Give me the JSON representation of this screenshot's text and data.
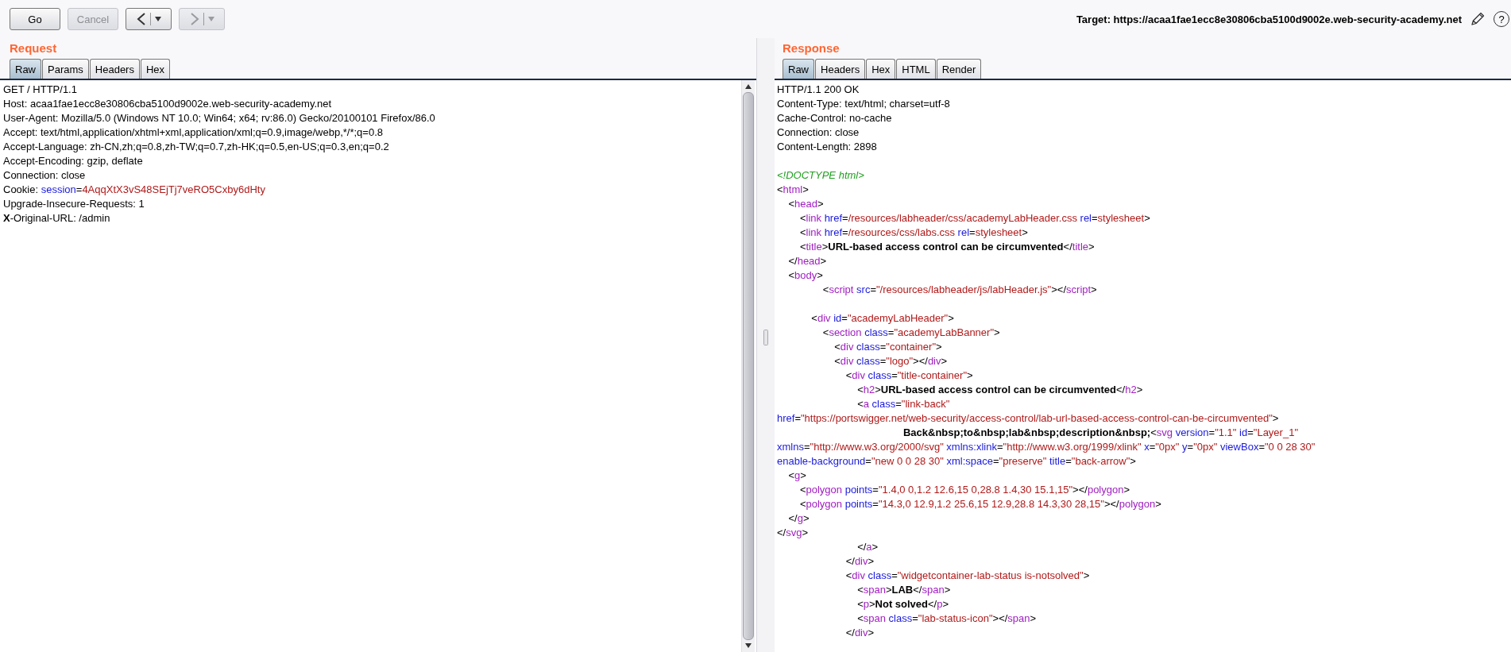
{
  "toolbar": {
    "buttons": [
      {
        "kind": "text",
        "label": "Go",
        "disabled": false
      },
      {
        "kind": "text",
        "label": "Cancel",
        "disabled": true
      },
      {
        "kind": "back",
        "disabled": false
      },
      {
        "kind": "forward",
        "disabled": true
      }
    ],
    "target": "Target: https://acaa1fae1ecc8e30806cba5100d9002e.web-security-academy.net",
    "help_label": "?"
  },
  "request": {
    "title": "Request",
    "tabs": [
      {
        "label": "Raw",
        "selected": true
      },
      {
        "label": "Params",
        "selected": false
      },
      {
        "label": "Headers",
        "selected": false
      },
      {
        "label": "Hex",
        "selected": false
      }
    ],
    "lines": [
      {
        "kind": "code",
        "segments": [
          {
            "kind": "plain",
            "text": "GET / HTTP/1.1"
          }
        ]
      },
      {
        "kind": "code",
        "segments": [
          {
            "kind": "plain",
            "text": "Host: acaa1fae1ecc8e30806cba5100d9002e.web-security-academy.net"
          }
        ]
      },
      {
        "kind": "code",
        "segments": [
          {
            "kind": "plain",
            "text": "User-Agent: Mozilla/5.0 (Windows NT 10.0; Win64; x64; rv:86.0) Gecko/20100101 Firefox/86.0"
          }
        ]
      },
      {
        "kind": "code",
        "segments": [
          {
            "kind": "plain",
            "text": "Accept: text/html,application/xhtml+xml,application/xml;q=0.9,image/webp,*/*;q=0.8"
          }
        ]
      },
      {
        "kind": "code",
        "segments": [
          {
            "kind": "plain",
            "text": "Accept-Language: zh-CN,zh;q=0.8,zh-TW;q=0.7,zh-HK;q=0.5,en-US;q=0.3,en;q=0.2"
          }
        ]
      },
      {
        "kind": "code",
        "segments": [
          {
            "kind": "plain",
            "text": "Accept-Encoding: gzip, deflate"
          }
        ]
      },
      {
        "kind": "code",
        "segments": [
          {
            "kind": "plain",
            "text": "Connection: close"
          }
        ]
      },
      {
        "kind": "code",
        "segments": [
          {
            "kind": "plain",
            "text": "Cookie: "
          },
          {
            "kind": "attr",
            "text": "session"
          },
          {
            "kind": "plain",
            "text": "="
          },
          {
            "kind": "value",
            "text": "4AqqXtX3vS48SEjTj7veRO5Cxby6dHty"
          }
        ]
      },
      {
        "kind": "code",
        "segments": [
          {
            "kind": "plain",
            "text": "Upgrade-Insecure-Requests: 1"
          }
        ]
      },
      {
        "kind": "code",
        "segments": [
          {
            "kind": "bold",
            "text": "X"
          },
          {
            "kind": "plain",
            "text": "-Original-URL: /admin"
          }
        ]
      }
    ]
  },
  "response": {
    "title": "Response",
    "tabs": [
      {
        "label": "Raw",
        "selected": true
      },
      {
        "label": "Headers",
        "selected": false
      },
      {
        "label": "Hex",
        "selected": false
      },
      {
        "label": "HTML",
        "selected": false
      },
      {
        "label": "Render",
        "selected": false
      }
    ],
    "lines": [
      {
        "kind": "code",
        "segments": [
          {
            "kind": "plain",
            "text": "HTTP/1.1 200 OK"
          }
        ]
      },
      {
        "kind": "code",
        "segments": [
          {
            "kind": "plain",
            "text": "Content-Type: text/html; charset=utf-8"
          }
        ]
      },
      {
        "kind": "code",
        "segments": [
          {
            "kind": "plain",
            "text": "Cache-Control: no-cache"
          }
        ]
      },
      {
        "kind": "code",
        "segments": [
          {
            "kind": "plain",
            "text": "Connection: close"
          }
        ]
      },
      {
        "kind": "code",
        "segments": [
          {
            "kind": "plain",
            "text": "Content-Length: 2898"
          }
        ]
      },
      {
        "kind": "blank"
      },
      {
        "kind": "code",
        "segments": [
          {
            "kind": "comment",
            "text": "<!DOCTYPE html>"
          }
        ]
      },
      {
        "kind": "code",
        "segments": [
          {
            "kind": "plain",
            "text": "<"
          },
          {
            "kind": "tag",
            "text": "html"
          },
          {
            "kind": "plain",
            "text": ">"
          }
        ]
      },
      {
        "kind": "code",
        "segments": [
          {
            "kind": "plain",
            "text": "    <"
          },
          {
            "kind": "tag",
            "text": "head"
          },
          {
            "kind": "plain",
            "text": ">"
          }
        ]
      },
      {
        "kind": "code",
        "segments": [
          {
            "kind": "plain",
            "text": "        <"
          },
          {
            "kind": "tag",
            "text": "link"
          },
          {
            "kind": "attr",
            "text": " href"
          },
          {
            "kind": "plain",
            "text": "="
          },
          {
            "kind": "value",
            "text": "/resources/labheader/css/academyLabHeader.css"
          },
          {
            "kind": "attr",
            "text": " rel"
          },
          {
            "kind": "plain",
            "text": "="
          },
          {
            "kind": "value",
            "text": "stylesheet"
          },
          {
            "kind": "plain",
            "text": ">"
          }
        ]
      },
      {
        "kind": "code",
        "segments": [
          {
            "kind": "plain",
            "text": "        <"
          },
          {
            "kind": "tag",
            "text": "link"
          },
          {
            "kind": "attr",
            "text": " href"
          },
          {
            "kind": "plain",
            "text": "="
          },
          {
            "kind": "value",
            "text": "/resources/css/labs.css"
          },
          {
            "kind": "attr",
            "text": " rel"
          },
          {
            "kind": "plain",
            "text": "="
          },
          {
            "kind": "value",
            "text": "stylesheet"
          },
          {
            "kind": "plain",
            "text": ">"
          }
        ]
      },
      {
        "kind": "code",
        "segments": [
          {
            "kind": "plain",
            "text": "        <"
          },
          {
            "kind": "tag",
            "text": "title"
          },
          {
            "kind": "plain",
            "text": ">"
          },
          {
            "kind": "bold",
            "text": "URL-based access control can be circumvented"
          },
          {
            "kind": "plain",
            "text": "</"
          },
          {
            "kind": "tag",
            "text": "title"
          },
          {
            "kind": "plain",
            "text": ">"
          }
        ]
      },
      {
        "kind": "code",
        "segments": [
          {
            "kind": "plain",
            "text": "    </"
          },
          {
            "kind": "tag",
            "text": "head"
          },
          {
            "kind": "plain",
            "text": ">"
          }
        ]
      },
      {
        "kind": "code",
        "segments": [
          {
            "kind": "plain",
            "text": "    <"
          },
          {
            "kind": "tag",
            "text": "body"
          },
          {
            "kind": "plain",
            "text": ">"
          }
        ]
      },
      {
        "kind": "code",
        "segments": [
          {
            "kind": "plain",
            "text": "                <"
          },
          {
            "kind": "tag",
            "text": "script"
          },
          {
            "kind": "attr",
            "text": " src"
          },
          {
            "kind": "plain",
            "text": "="
          },
          {
            "kind": "value",
            "text": "\"/resources/labheader/js/labHeader.js\""
          },
          {
            "kind": "plain",
            "text": "></"
          },
          {
            "kind": "tag",
            "text": "script"
          },
          {
            "kind": "plain",
            "text": ">"
          }
        ]
      },
      {
        "kind": "blank"
      },
      {
        "kind": "code",
        "segments": [
          {
            "kind": "plain",
            "text": "            <"
          },
          {
            "kind": "tag",
            "text": "div"
          },
          {
            "kind": "attr",
            "text": " id"
          },
          {
            "kind": "plain",
            "text": "="
          },
          {
            "kind": "value",
            "text": "\"academyLabHeader\""
          },
          {
            "kind": "plain",
            "text": ">"
          }
        ]
      },
      {
        "kind": "code",
        "segments": [
          {
            "kind": "plain",
            "text": "                <"
          },
          {
            "kind": "tag",
            "text": "section"
          },
          {
            "kind": "attr",
            "text": " class"
          },
          {
            "kind": "plain",
            "text": "="
          },
          {
            "kind": "value",
            "text": "\"academyLabBanner\""
          },
          {
            "kind": "plain",
            "text": ">"
          }
        ]
      },
      {
        "kind": "code",
        "segments": [
          {
            "kind": "plain",
            "text": "                    <"
          },
          {
            "kind": "tag",
            "text": "div"
          },
          {
            "kind": "attr",
            "text": " class"
          },
          {
            "kind": "plain",
            "text": "="
          },
          {
            "kind": "value",
            "text": "\"container\""
          },
          {
            "kind": "plain",
            "text": ">"
          }
        ]
      },
      {
        "kind": "code",
        "segments": [
          {
            "kind": "plain",
            "text": "                    <"
          },
          {
            "kind": "tag",
            "text": "div"
          },
          {
            "kind": "attr",
            "text": " class"
          },
          {
            "kind": "plain",
            "text": "="
          },
          {
            "kind": "value",
            "text": "\"logo\""
          },
          {
            "kind": "plain",
            "text": "></"
          },
          {
            "kind": "tag",
            "text": "div"
          },
          {
            "kind": "plain",
            "text": ">"
          }
        ]
      },
      {
        "kind": "code",
        "segments": [
          {
            "kind": "plain",
            "text": "                        <"
          },
          {
            "kind": "tag",
            "text": "div"
          },
          {
            "kind": "attr",
            "text": " class"
          },
          {
            "kind": "plain",
            "text": "="
          },
          {
            "kind": "value",
            "text": "\"title-container\""
          },
          {
            "kind": "plain",
            "text": ">"
          }
        ]
      },
      {
        "kind": "code",
        "segments": [
          {
            "kind": "plain",
            "text": "                            <"
          },
          {
            "kind": "tag",
            "text": "h2"
          },
          {
            "kind": "plain",
            "text": ">"
          },
          {
            "kind": "bold",
            "text": "URL-based access control can be circumvented"
          },
          {
            "kind": "plain",
            "text": "</"
          },
          {
            "kind": "tag",
            "text": "h2"
          },
          {
            "kind": "plain",
            "text": ">"
          }
        ]
      },
      {
        "kind": "code",
        "segments": [
          {
            "kind": "plain",
            "text": "                            <"
          },
          {
            "kind": "tag",
            "text": "a"
          },
          {
            "kind": "attr",
            "text": " class"
          },
          {
            "kind": "plain",
            "text": "="
          },
          {
            "kind": "value",
            "text": "\"link-back\""
          }
        ]
      },
      {
        "kind": "code",
        "segments": [
          {
            "kind": "attr",
            "text": "href"
          },
          {
            "kind": "plain",
            "text": "="
          },
          {
            "kind": "value",
            "text": "\"https://portswigger.net/web-security/access-control/lab-url-based-access-control-can-be-circumvented\""
          },
          {
            "kind": "plain",
            "text": ">"
          }
        ]
      },
      {
        "kind": "code",
        "segments": [
          {
            "kind": "bold",
            "text": "                                            Back&nbsp;to&nbsp;lab&nbsp;description&nbsp;"
          },
          {
            "kind": "plain",
            "text": "<"
          },
          {
            "kind": "tag",
            "text": "svg"
          },
          {
            "kind": "attr",
            "text": " version"
          },
          {
            "kind": "plain",
            "text": "="
          },
          {
            "kind": "value",
            "text": "\"1.1\""
          },
          {
            "kind": "attr",
            "text": " id"
          },
          {
            "kind": "plain",
            "text": "="
          },
          {
            "kind": "value",
            "text": "\"Layer_1\""
          }
        ]
      },
      {
        "kind": "code",
        "segments": [
          {
            "kind": "attr",
            "text": "xmlns"
          },
          {
            "kind": "plain",
            "text": "="
          },
          {
            "kind": "value",
            "text": "\"http://www.w3.org/2000/svg\""
          },
          {
            "kind": "attr",
            "text": " xmlns:xlink"
          },
          {
            "kind": "plain",
            "text": "="
          },
          {
            "kind": "value",
            "text": "\"http://www.w3.org/1999/xlink\""
          },
          {
            "kind": "attr",
            "text": " x"
          },
          {
            "kind": "plain",
            "text": "="
          },
          {
            "kind": "value",
            "text": "\"0px\""
          },
          {
            "kind": "attr",
            "text": " y"
          },
          {
            "kind": "plain",
            "text": "="
          },
          {
            "kind": "value",
            "text": "\"0px\""
          },
          {
            "kind": "attr",
            "text": " viewBox"
          },
          {
            "kind": "plain",
            "text": "="
          },
          {
            "kind": "value",
            "text": "\"0 0 28 30\""
          }
        ]
      },
      {
        "kind": "code",
        "segments": [
          {
            "kind": "attr",
            "text": "enable-background"
          },
          {
            "kind": "plain",
            "text": "="
          },
          {
            "kind": "value",
            "text": "\"new 0 0 28 30\""
          },
          {
            "kind": "attr",
            "text": " xml:space"
          },
          {
            "kind": "plain",
            "text": "="
          },
          {
            "kind": "value",
            "text": "\"preserve\""
          },
          {
            "kind": "attr",
            "text": " title"
          },
          {
            "kind": "plain",
            "text": "="
          },
          {
            "kind": "value",
            "text": "\"back-arrow\""
          },
          {
            "kind": "plain",
            "text": ">"
          }
        ]
      },
      {
        "kind": "code",
        "segments": [
          {
            "kind": "plain",
            "text": "    <"
          },
          {
            "kind": "tag",
            "text": "g"
          },
          {
            "kind": "plain",
            "text": ">"
          }
        ]
      },
      {
        "kind": "code",
        "segments": [
          {
            "kind": "plain",
            "text": "        <"
          },
          {
            "kind": "tag",
            "text": "polygon"
          },
          {
            "kind": "attr",
            "text": " points"
          },
          {
            "kind": "plain",
            "text": "="
          },
          {
            "kind": "value",
            "text": "\"1.4,0 0,1.2 12.6,15 0,28.8 1.4,30 15.1,15\""
          },
          {
            "kind": "plain",
            "text": "></"
          },
          {
            "kind": "tag",
            "text": "polygon"
          },
          {
            "kind": "plain",
            "text": ">"
          }
        ]
      },
      {
        "kind": "code",
        "segments": [
          {
            "kind": "plain",
            "text": "        <"
          },
          {
            "kind": "tag",
            "text": "polygon"
          },
          {
            "kind": "attr",
            "text": " points"
          },
          {
            "kind": "plain",
            "text": "="
          },
          {
            "kind": "value",
            "text": "\"14.3,0 12.9,1.2 25.6,15 12.9,28.8 14.3,30 28,15\""
          },
          {
            "kind": "plain",
            "text": "></"
          },
          {
            "kind": "tag",
            "text": "polygon"
          },
          {
            "kind": "plain",
            "text": ">"
          }
        ]
      },
      {
        "kind": "code",
        "segments": [
          {
            "kind": "plain",
            "text": "    </"
          },
          {
            "kind": "tag",
            "text": "g"
          },
          {
            "kind": "plain",
            "text": ">"
          }
        ]
      },
      {
        "kind": "code",
        "segments": [
          {
            "kind": "plain",
            "text": "</"
          },
          {
            "kind": "tag",
            "text": "svg"
          },
          {
            "kind": "plain",
            "text": ">"
          }
        ]
      },
      {
        "kind": "code",
        "segments": [
          {
            "kind": "plain",
            "text": "                            </"
          },
          {
            "kind": "tag",
            "text": "a"
          },
          {
            "kind": "plain",
            "text": ">"
          }
        ]
      },
      {
        "kind": "code",
        "segments": [
          {
            "kind": "plain",
            "text": "                        </"
          },
          {
            "kind": "tag",
            "text": "div"
          },
          {
            "kind": "plain",
            "text": ">"
          }
        ]
      },
      {
        "kind": "code",
        "segments": [
          {
            "kind": "plain",
            "text": "                        <"
          },
          {
            "kind": "tag",
            "text": "div"
          },
          {
            "kind": "attr",
            "text": " class"
          },
          {
            "kind": "plain",
            "text": "="
          },
          {
            "kind": "value",
            "text": "\"widgetcontainer-lab-status is-notsolved\""
          },
          {
            "kind": "plain",
            "text": ">"
          }
        ]
      },
      {
        "kind": "code",
        "segments": [
          {
            "kind": "plain",
            "text": "                            <"
          },
          {
            "kind": "tag",
            "text": "span"
          },
          {
            "kind": "plain",
            "text": ">"
          },
          {
            "kind": "bold",
            "text": "LAB"
          },
          {
            "kind": "plain",
            "text": "</"
          },
          {
            "kind": "tag",
            "text": "span"
          },
          {
            "kind": "plain",
            "text": ">"
          }
        ]
      },
      {
        "kind": "code",
        "segments": [
          {
            "kind": "plain",
            "text": "                            <"
          },
          {
            "kind": "tag",
            "text": "p"
          },
          {
            "kind": "plain",
            "text": ">"
          },
          {
            "kind": "bold",
            "text": "Not solved"
          },
          {
            "kind": "plain",
            "text": "</"
          },
          {
            "kind": "tag",
            "text": "p"
          },
          {
            "kind": "plain",
            "text": ">"
          }
        ]
      },
      {
        "kind": "code",
        "segments": [
          {
            "kind": "plain",
            "text": "                            <"
          },
          {
            "kind": "tag",
            "text": "span"
          },
          {
            "kind": "attr",
            "text": " class"
          },
          {
            "kind": "plain",
            "text": "="
          },
          {
            "kind": "value",
            "text": "\"lab-status-icon\""
          },
          {
            "kind": "plain",
            "text": "></"
          },
          {
            "kind": "tag",
            "text": "span"
          },
          {
            "kind": "plain",
            "text": ">"
          }
        ]
      },
      {
        "kind": "code",
        "segments": [
          {
            "kind": "plain",
            "text": "                        </"
          },
          {
            "kind": "tag",
            "text": "div"
          },
          {
            "kind": "plain",
            "text": ">"
          }
        ]
      }
    ]
  }
}
